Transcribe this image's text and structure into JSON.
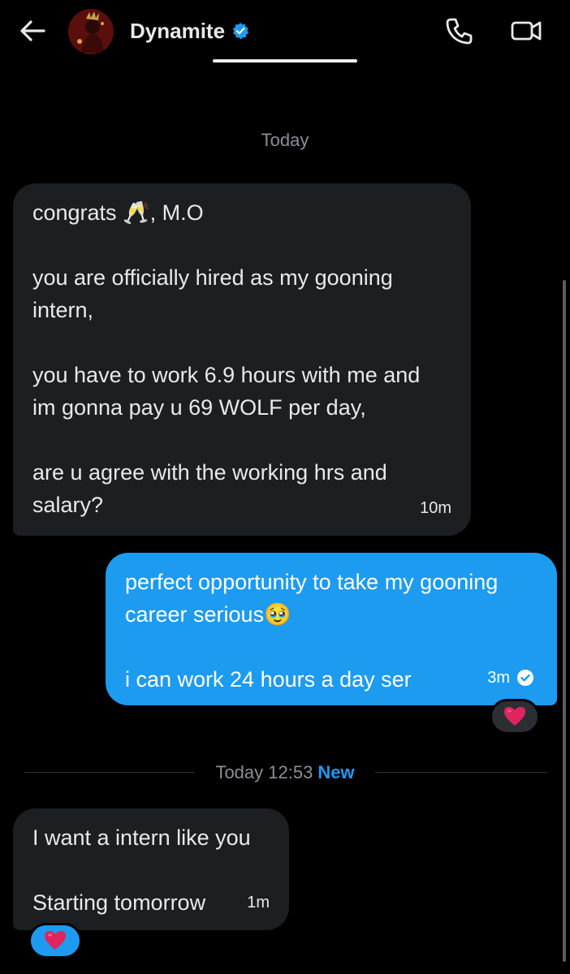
{
  "header": {
    "title": "Dynamite",
    "verified": true,
    "accent_color": "#1d9bf0"
  },
  "conversation": {
    "day_label": "Today",
    "messages": [
      {
        "direction": "incoming",
        "text": "congrats 🥂, M.O\n\nyou are officially hired as my gooning\nintern,\n\nyou have to work 6.9 hours with me and\nim gonna pay u 69 WOLF per day,\n\nare u agree with the working hrs and\nsalary?",
        "time": "10m"
      },
      {
        "direction": "outgoing",
        "text": "perfect opportunity to take my gooning\ncareer serious🥹\n\ni can work 24 hours a day ser",
        "time": "3m",
        "read": true,
        "reaction": "red-heart"
      },
      {
        "direction": "incoming",
        "text": "I want a intern like you\n\nStarting tomorrow",
        "time": "1m",
        "reaction": "red-heart"
      }
    ],
    "new_divider": {
      "label": "Today 12:53",
      "tag": "New"
    }
  },
  "icons": {
    "back": "arrow-left-icon",
    "call": "phone-icon",
    "video": "video-camera-icon",
    "verified": "verified-badge-icon",
    "reaction": "heart-icon"
  },
  "colors": {
    "background": "#000000",
    "incoming_bubble": "#1c1f22",
    "outgoing_bubble": "#1d9bf0",
    "muted_text": "#8b8f94",
    "heart": "#e0245e"
  }
}
